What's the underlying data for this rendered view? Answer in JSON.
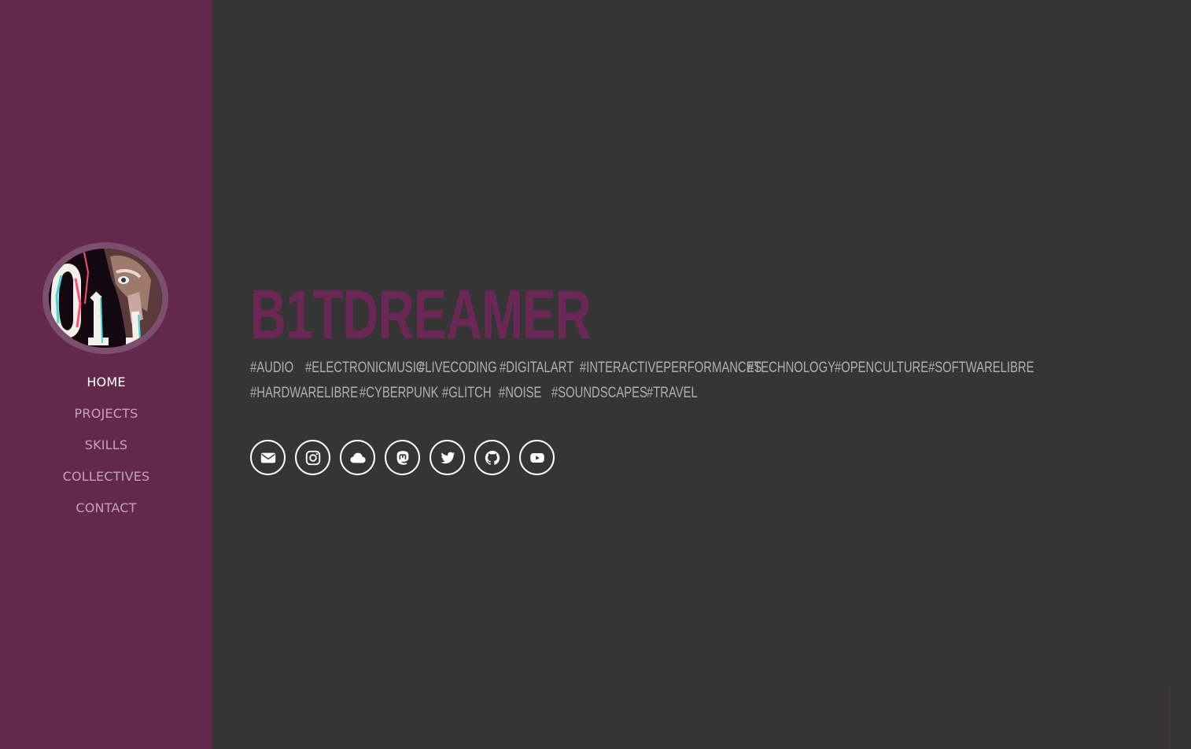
{
  "sidebar": {
    "nav": [
      "HOME",
      "PROJECTS",
      "SKILLS",
      "COLLECTIVES",
      "CONTACT"
    ],
    "active": "HOME"
  },
  "main": {
    "title": "B1TDREAMER",
    "tags_row1": [
      "#AUDIO",
      "#ELECTRONICMUSIC",
      "#LIVECODING",
      "#DIGITALART",
      "#INTERACTIVEPERFORMANCES",
      "#TECHNOLOGY",
      "#OPENCULTURE",
      "#SOFTWARELIBRE"
    ],
    "tags_row2": [
      "#HARDWARELIBRE",
      "#CYBERPUNK",
      "#GLITCH",
      "#NOISE",
      "#SOUNDSCAPES",
      "#TRAVEL"
    ]
  },
  "socials": [
    "envelope-icon",
    "instagram-icon",
    "cloud-icon",
    "mastodon-icon",
    "twitter-icon",
    "github-icon",
    "youtube-icon"
  ],
  "colors": {
    "sidebar": "#62294d",
    "background": "#363536",
    "title": "#6b2756",
    "tags": "#b1aeb0",
    "nav": "#c3a3b7",
    "nav_active": "#ffffff"
  }
}
